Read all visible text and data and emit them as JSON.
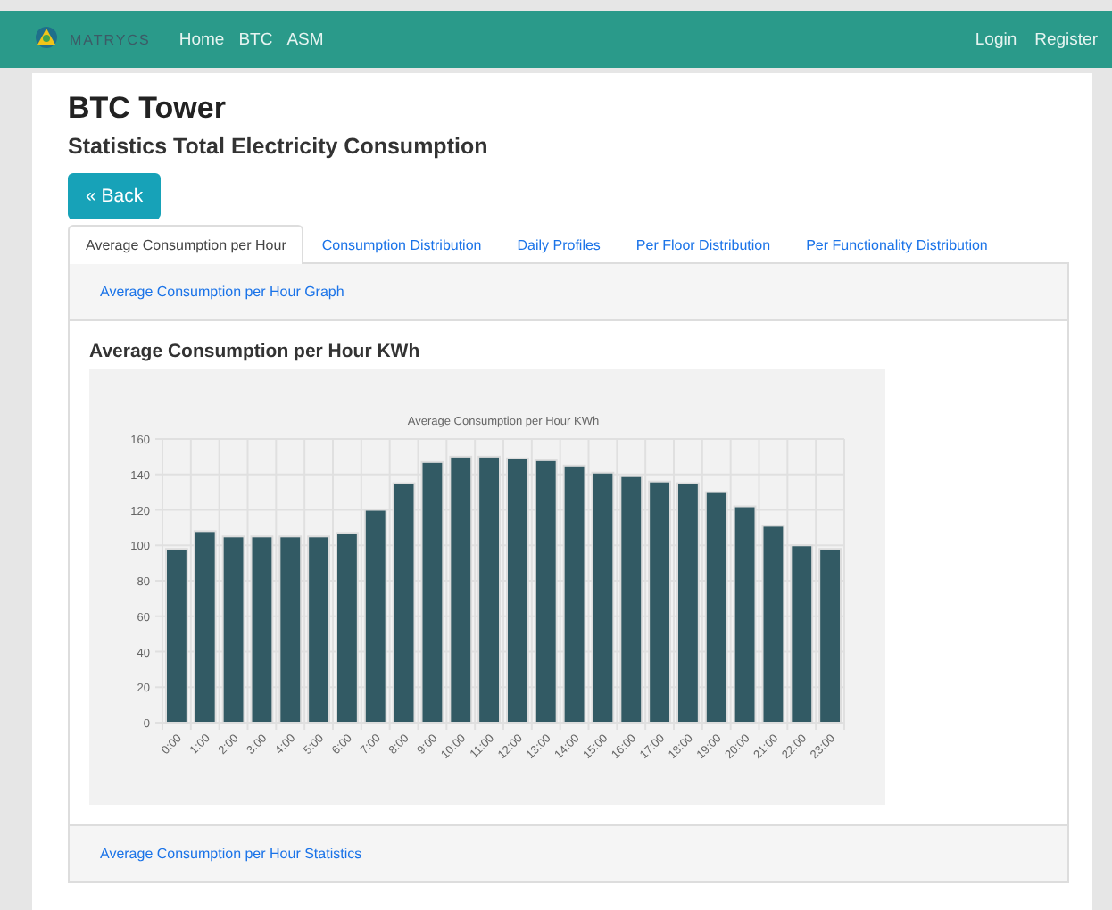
{
  "navbar": {
    "brand": "MATRYCS",
    "links": [
      "Home",
      "BTC",
      "ASM"
    ],
    "right_links": [
      "Login",
      "Register"
    ]
  },
  "title": "BTC Tower",
  "subtitle": "Statistics Total Electricity Consumption",
  "back_button": "« Back",
  "tabs": [
    {
      "label": "Average Consumption per Hour",
      "selected": true
    },
    {
      "label": "Consumption Distribution",
      "selected": false
    },
    {
      "label": "Daily Profiles",
      "selected": false
    },
    {
      "label": "Per Floor Distribution",
      "selected": false
    },
    {
      "label": "Per Functionality Distribution",
      "selected": false
    }
  ],
  "panel_header": "Average Consumption per Hour Graph",
  "section_title": "Average Consumption per Hour KWh",
  "chart_data": {
    "type": "bar",
    "title": "Average Consumption per Hour KWh",
    "categories": [
      "0:00",
      "1:00",
      "2:00",
      "3:00",
      "4:00",
      "5:00",
      "6:00",
      "7:00",
      "8:00",
      "9:00",
      "10:00",
      "11:00",
      "12:00",
      "13:00",
      "14:00",
      "15:00",
      "16:00",
      "17:00",
      "18:00",
      "19:00",
      "20:00",
      "21:00",
      "22:00",
      "23:00"
    ],
    "grid": true,
    "series": [
      {
        "color": "#325a64",
        "values": [
          98,
          108,
          105,
          105,
          105,
          105,
          107,
          120,
          135,
          147,
          150,
          150,
          149,
          148,
          145,
          141,
          139,
          136,
          135,
          130,
          122,
          111,
          100,
          98
        ]
      }
    ],
    "ylim": [
      0,
      160
    ],
    "yticks": [
      0,
      20,
      40,
      60,
      80,
      100,
      120,
      140,
      160
    ]
  },
  "panel_footer": "Average Consumption per Hour Statistics"
}
